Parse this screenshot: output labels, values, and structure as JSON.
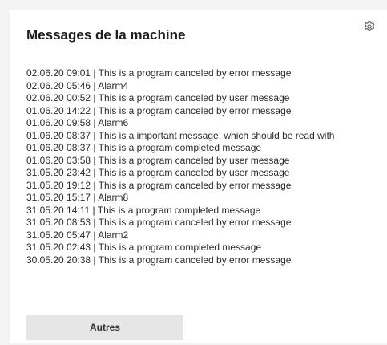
{
  "panel": {
    "title": "Messages de la machine",
    "settings_icon": "gear-icon",
    "more_button_label": "Autres"
  },
  "messages": [
    "02.06.20 09:01 | This is a program canceled by error message",
    "02.06.20 05:46 | Alarm4",
    "02.06.20 00:52 | This is a program canceled by user message",
    "01.06.20 14:22 | This is a program canceled by error message",
    "01.06.20 09:58 | Alarm6",
    "01.06.20 08:37 | This is a important message, which should be read with",
    "01.06.20 08:37 | This is a program completed message",
    "01.06.20 03:58 | This is a program canceled by user message",
    "31.05.20 23:42 | This is a program canceled by user message",
    "31.05.20 19:12 | This is a program canceled by error message",
    "31.05.20 15:17 | Alarm8",
    "31.05.20 14:11 | This is a program completed message",
    "31.05.20 08:53 | This is a program canceled by error message",
    "31.05.20 05:47 | Alarm2",
    "31.05.20 02:43 | This is a program completed message",
    "30.05.20 20:38 | This is a program canceled by error message"
  ]
}
